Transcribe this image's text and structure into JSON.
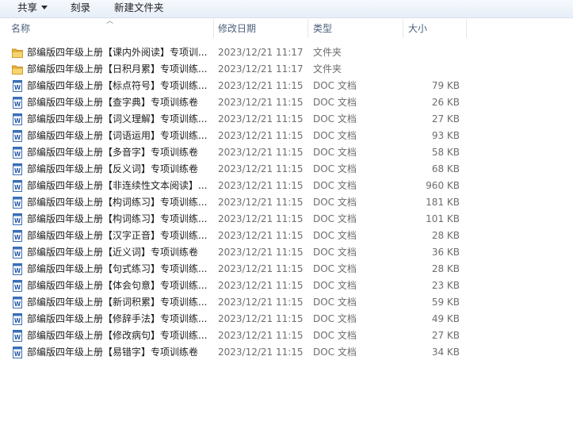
{
  "toolbar": {
    "share": "共享",
    "burn": "刻录",
    "new_folder": "新建文件夹"
  },
  "columns": {
    "name": "名称",
    "date": "修改日期",
    "type": "类型",
    "size": "大小"
  },
  "files": [
    {
      "name": "部编版四年级上册【课内外阅读】专项训...",
      "date": "2023/12/21 11:17",
      "type": "文件夹",
      "size": "",
      "icon": "folder-icon"
    },
    {
      "name": "部编版四年级上册【日积月累】专项训练...",
      "date": "2023/12/21 11:17",
      "type": "文件夹",
      "size": "",
      "icon": "folder-icon"
    },
    {
      "name": "部编版四年级上册【标点符号】专项训练...",
      "date": "2023/12/21 11:15",
      "type": "DOC 文档",
      "size": "79 KB",
      "icon": "doc-icon"
    },
    {
      "name": "部编版四年级上册【查字典】专项训练卷",
      "date": "2023/12/21 11:15",
      "type": "DOC 文档",
      "size": "26 KB",
      "icon": "doc-icon"
    },
    {
      "name": "部编版四年级上册【词义理解】专项训练...",
      "date": "2023/12/21 11:15",
      "type": "DOC 文档",
      "size": "27 KB",
      "icon": "doc-icon"
    },
    {
      "name": "部编版四年级上册【词语运用】专项训练...",
      "date": "2023/12/21 11:15",
      "type": "DOC 文档",
      "size": "93 KB",
      "icon": "doc-icon"
    },
    {
      "name": "部编版四年级上册【多音字】专项训练卷",
      "date": "2023/12/21 11:15",
      "type": "DOC 文档",
      "size": "58 KB",
      "icon": "doc-icon"
    },
    {
      "name": "部编版四年级上册【反义词】专项训练卷",
      "date": "2023/12/21 11:15",
      "type": "DOC 文档",
      "size": "68 KB",
      "icon": "doc-icon"
    },
    {
      "name": "部编版四年级上册【非连续性文本阅读】...",
      "date": "2023/12/21 11:15",
      "type": "DOC 文档",
      "size": "960 KB",
      "icon": "doc-icon"
    },
    {
      "name": "部编版四年级上册【构词练习】专项训练...",
      "date": "2023/12/21 11:15",
      "type": "DOC 文档",
      "size": "181 KB",
      "icon": "doc-icon"
    },
    {
      "name": "部编版四年级上册【构词练习】专项训练...",
      "date": "2023/12/21 11:15",
      "type": "DOC 文档",
      "size": "101 KB",
      "icon": "doc-icon"
    },
    {
      "name": "部编版四年级上册【汉字正音】专项训练...",
      "date": "2023/12/21 11:15",
      "type": "DOC 文档",
      "size": "28 KB",
      "icon": "doc-icon"
    },
    {
      "name": "部编版四年级上册【近义词】专项训练卷",
      "date": "2023/12/21 11:15",
      "type": "DOC 文档",
      "size": "36 KB",
      "icon": "doc-icon"
    },
    {
      "name": "部编版四年级上册【句式练习】专项训练...",
      "date": "2023/12/21 11:15",
      "type": "DOC 文档",
      "size": "28 KB",
      "icon": "doc-icon"
    },
    {
      "name": "部编版四年级上册【体会句意】专项训练...",
      "date": "2023/12/21 11:15",
      "type": "DOC 文档",
      "size": "23 KB",
      "icon": "doc-icon"
    },
    {
      "name": "部编版四年级上册【新词积累】专项训练...",
      "date": "2023/12/21 11:15",
      "type": "DOC 文档",
      "size": "59 KB",
      "icon": "doc-icon"
    },
    {
      "name": "部编版四年级上册【修辞手法】专项训练...",
      "date": "2023/12/21 11:15",
      "type": "DOC 文档",
      "size": "49 KB",
      "icon": "doc-icon"
    },
    {
      "name": "部编版四年级上册【修改病句】专项训练...",
      "date": "2023/12/21 11:15",
      "type": "DOC 文档",
      "size": "27 KB",
      "icon": "doc-icon"
    },
    {
      "name": "部编版四年级上册【易错字】专项训练卷",
      "date": "2023/12/21 11:15",
      "type": "DOC 文档",
      "size": "34 KB",
      "icon": "doc-icon"
    }
  ]
}
